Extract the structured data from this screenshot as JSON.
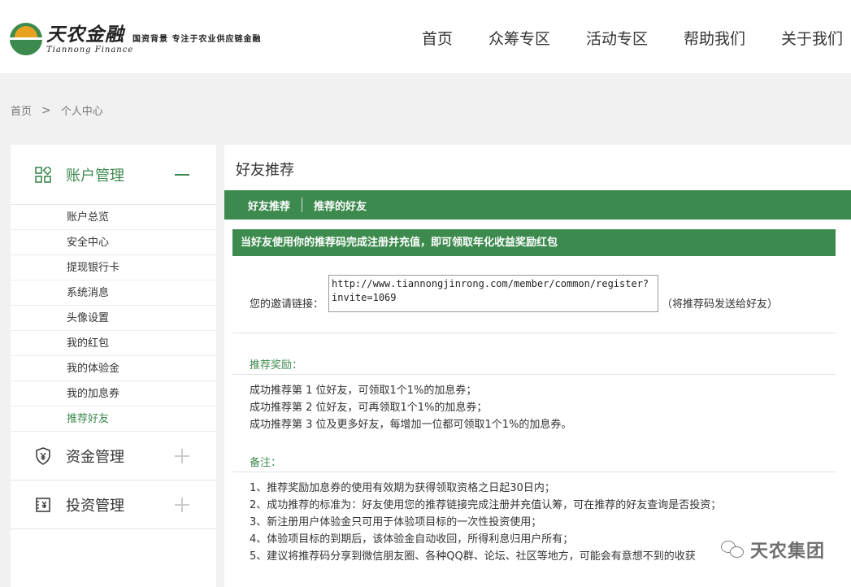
{
  "brand": {
    "name_cn": "天农金融",
    "name_en": "Tiannong Finance",
    "slogan": "国资背景 专注于农业供应链金融"
  },
  "nav": [
    "首页",
    "众筹专区",
    "活动专区",
    "帮助我们",
    "关于我们"
  ],
  "breadcrumb": {
    "home": "首页",
    "current": "个人中心"
  },
  "sidebar": {
    "account": {
      "label": "账户管理",
      "items": [
        "账户总览",
        "安全中心",
        "提现银行卡",
        "系统消息",
        "头像设置",
        "我的红包",
        "我的体验金",
        "我的加息券",
        "推荐好友"
      ],
      "active_item": "推荐好友"
    },
    "funds": {
      "label": "资金管理"
    },
    "investment": {
      "label": "投资管理"
    }
  },
  "main": {
    "title": "好友推荐",
    "tabs": [
      "好友推荐",
      "推荐的好友"
    ],
    "notice": "当好友使用你的推荐码完成注册并充值，即可领取年化收益奖励红包",
    "invite": {
      "label": "您的邀请链接：",
      "value": "http://www.tiannongjinrong.com/member/common/register?invite=1069",
      "hint": "（将推荐码发送给好友）"
    },
    "reward": {
      "title": "推荐奖励：",
      "lines": [
        "成功推荐第 1 位好友，可领取1个1%的加息券；",
        "成功推荐第 2 位好友，可再领取1个1%的加息券；",
        "成功推荐第 3 位及更多好友，每增加一位都可领取1个1%的加息券。"
      ]
    },
    "notes": {
      "title": "备注：",
      "lines": [
        "1、推荐奖励加息券的使用有效期为获得领取资格之日起30日内；",
        "2、成功推荐的标准为：好友使用您的推荐链接完成注册并充值认筹，可在推荐的好友查询是否投资；",
        "3、新注册用户体验金只可用于体验项目标的一次性投资使用；",
        "4、体验项目标的到期后，该体验金自动收回，所得利息归用户所有；",
        "5、建议将推荐码分享到微信朋友圈、各种QQ群、论坛、社区等地方，可能会有意想不到的收获"
      ]
    }
  },
  "watermark": "天农集团",
  "colors": {
    "accent": "#3d8a4f",
    "logo_sun": "#e6a21f"
  }
}
